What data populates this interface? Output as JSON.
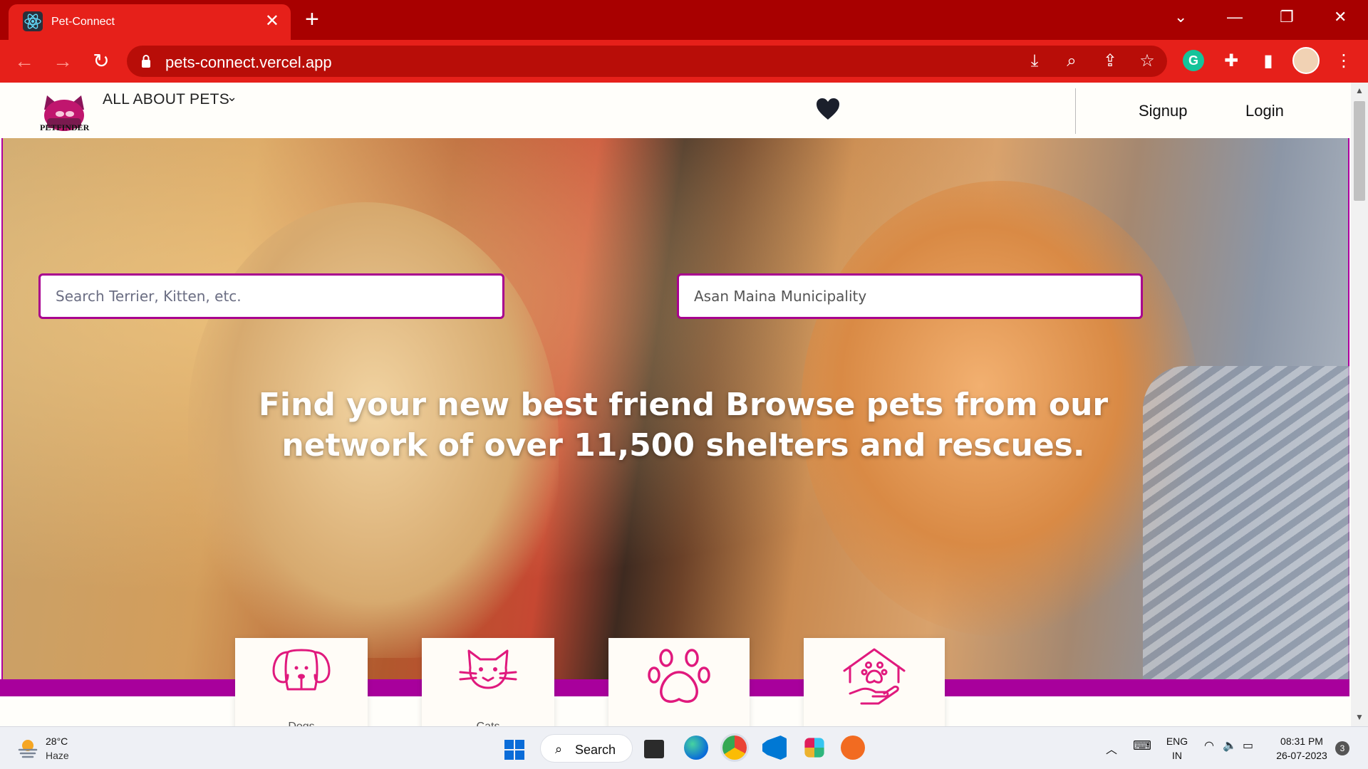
{
  "browser": {
    "tab_title": "Pet-Connect",
    "tab_close": "✕",
    "new_tab": "+",
    "url": "pets-connect.vercel.app",
    "controls": {
      "tab_list": "⌄",
      "minimize": "—",
      "restore": "❐",
      "close": "✕"
    }
  },
  "site": {
    "logo_text": "PETFINDER",
    "menu_label": "ALL ABOUT PETS",
    "signup": "Signup",
    "login": "Login",
    "search_placeholder": "Search Terrier, Kitten, etc.",
    "location_value": "Asan Maina Municipality",
    "hero_heading": "Find your new best friend Browse pets from our network of over 11,500 shelters and rescues.",
    "categories": [
      {
        "label": "Dogs",
        "icon": "dog-icon"
      },
      {
        "label": "Cats",
        "icon": "cat-icon"
      },
      {
        "label": "",
        "icon": "paw-icon"
      },
      {
        "label": "",
        "icon": "shelter-icon"
      }
    ],
    "accent": "#a8009c",
    "icon_color": "#e0197d"
  },
  "taskbar": {
    "temperature": "28°C",
    "weather": "Haze",
    "search_label": "Search",
    "language": "ENG",
    "region": "IN",
    "time": "08:31 PM",
    "date": "26-07-2023",
    "notifications": "3"
  }
}
